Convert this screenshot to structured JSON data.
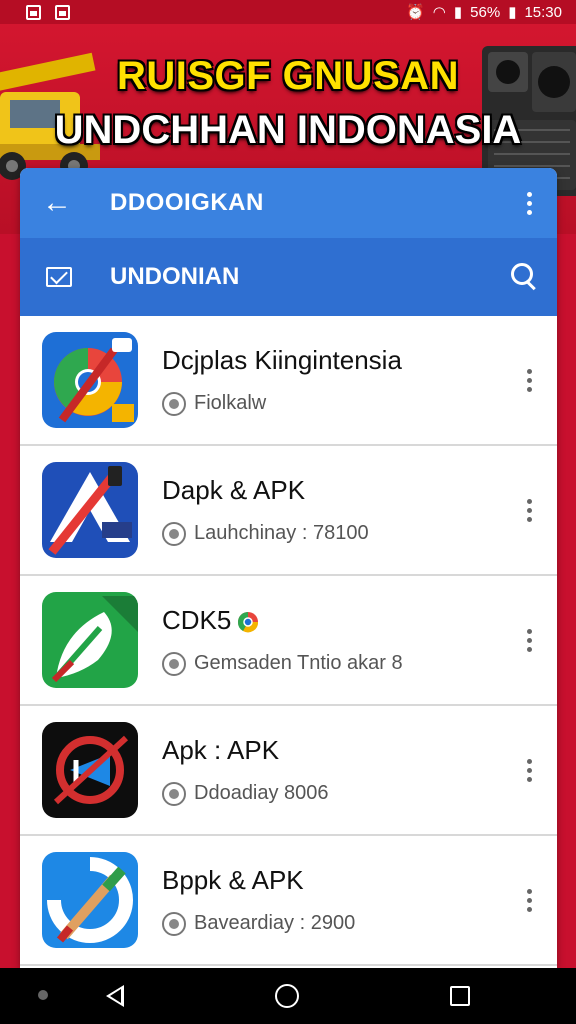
{
  "status_bar": {
    "battery": "56%",
    "time": "15:30"
  },
  "banner": {
    "title": "RUISGF GNUSAN",
    "subtitle": "UNDCHHAN INDONASIA"
  },
  "app_bar": {
    "title": "DDOOIGKAN"
  },
  "sub_bar": {
    "title": "UNDONIAN"
  },
  "apps": [
    {
      "name": "Dcjplas Kiingintensia",
      "meta": "Fiolkalw"
    },
    {
      "name": "Dapk & APK",
      "meta": "Lauhchinay : 78100"
    },
    {
      "name": "CDK5",
      "meta": "Gemsaden Tntio akar 8"
    },
    {
      "name": "Apk : APK",
      "meta": "Ddoadiay     8006"
    },
    {
      "name": "Bppk & APK",
      "meta": "Baveardiay : 2900"
    }
  ],
  "colors": {
    "background": "#c8102e",
    "app_bar": "#3a82e0",
    "sub_bar": "#2f6fd1",
    "banner_title": "#ffe100"
  }
}
